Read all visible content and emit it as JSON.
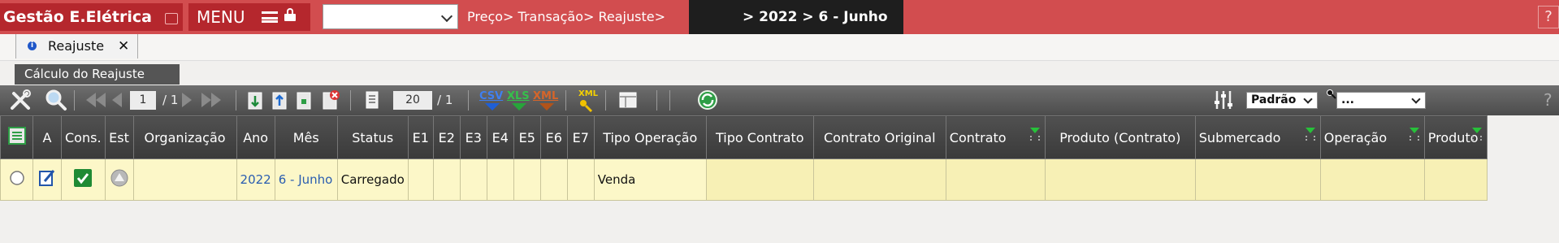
{
  "app": {
    "title": "Gestão E.Elétrica",
    "menu_label": "MENU"
  },
  "breadcrumb": {
    "path": "Preço> Transação> Reajuste>",
    "period": "> 2022 > 6 - Junho",
    "help": "?"
  },
  "tabs": [
    {
      "label": "Reajuste",
      "close": "✕"
    }
  ],
  "subtab": {
    "label": "Cálculo do Reajuste"
  },
  "toolbar": {
    "page_current": "1",
    "page_total": "/ 1",
    "rows_per_page": "20",
    "rows_total": "/ 1",
    "csv": "CSV",
    "xls": "XLS",
    "xml": "XML",
    "export_xml": "XML",
    "view_select": "Padrão",
    "filter_select": "...",
    "help": "?"
  },
  "colors": {
    "topbar": "#d24d4f",
    "brand": "#b5272d",
    "row_bg": "#fcf7c8",
    "csv": "#1f5fd6",
    "xls": "#27a53a",
    "xml": "#b2531a"
  },
  "table": {
    "columns": [
      "",
      "A",
      "Cons.",
      "Est",
      "Organização",
      "Ano",
      "Mês",
      "Status",
      "E1",
      "E2",
      "E3",
      "E4",
      "E5",
      "E6",
      "E7",
      "Tipo Operação",
      "Tipo Contrato",
      "Contrato Original",
      "Contrato",
      "Produto (Contrato)",
      "Submercado",
      "Operação",
      "Produto"
    ],
    "rows": [
      {
        "organizacao": "",
        "ano": "2022",
        "mes": "6 - Junho",
        "status": "Carregado",
        "tipo_operacao": "Venda",
        "tipo_contrato": "",
        "contrato_original": "",
        "contrato": "",
        "produto_contrato": "",
        "submercado": "",
        "operacao": "",
        "produto": ""
      }
    ]
  }
}
